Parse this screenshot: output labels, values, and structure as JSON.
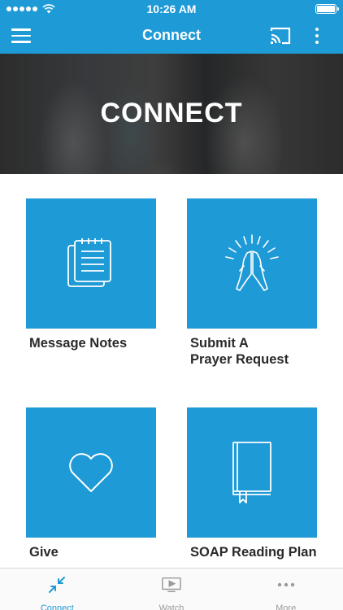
{
  "status_bar": {
    "time": "10:26 AM"
  },
  "app_bar": {
    "title": "Connect"
  },
  "hero": {
    "title": "CONNECT"
  },
  "tiles": [
    {
      "label": "Message Notes",
      "icon": "notes-icon"
    },
    {
      "label_line1": "Submit A",
      "label_line2": "Prayer Request",
      "icon": "praying-hands-icon"
    },
    {
      "label": "Give",
      "icon": "heart-icon"
    },
    {
      "label": "SOAP Reading Plan",
      "icon": "book-icon"
    }
  ],
  "tab_bar": {
    "tabs": [
      {
        "label": "Connect",
        "icon": "connect-icon",
        "active": true
      },
      {
        "label": "Watch",
        "icon": "tv-play-icon",
        "active": false
      },
      {
        "label": "More",
        "icon": "more-dots-icon",
        "active": false
      }
    ]
  },
  "colors": {
    "accent": "#1e9ad6",
    "inactive": "#9a9a9a",
    "text": "#2a2a2a"
  }
}
